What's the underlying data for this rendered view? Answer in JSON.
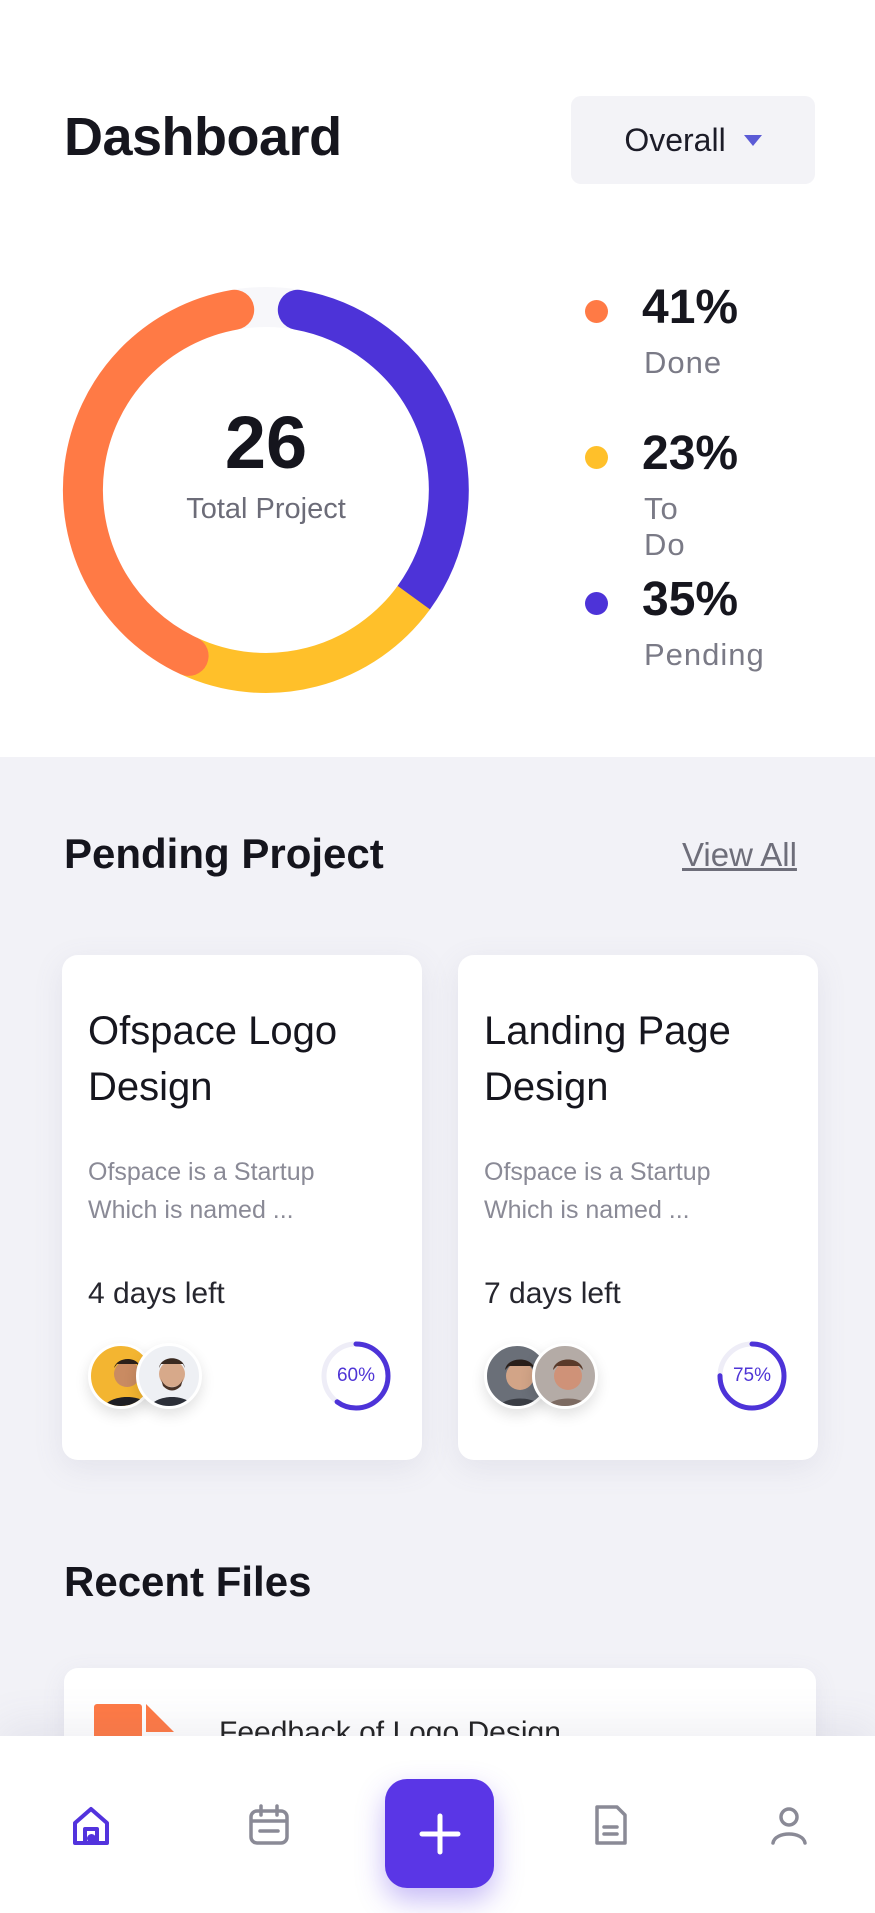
{
  "header": {
    "title": "Dashboard",
    "filter_label": "Overall"
  },
  "summary": {
    "total_value": "26",
    "total_label": "Total Project",
    "colors": {
      "done": "#ff7a45",
      "todo": "#ffc02a",
      "pending": "#4d33d8"
    },
    "legend": [
      {
        "pct": "41%",
        "label": "Done",
        "color": "#ff7a45"
      },
      {
        "pct": "23%",
        "label": "To Do",
        "color": "#ffc02a"
      },
      {
        "pct": "35%",
        "label": "Pending",
        "color": "#4d33d8"
      }
    ]
  },
  "pending": {
    "title": "Pending Project",
    "view_all": "View All",
    "cards": [
      {
        "title_line1": "Ofspace Logo",
        "title_line2": "Design",
        "desc_line1": "Ofspace is a Startup",
        "desc_line2": "Which is named ...",
        "days": "4 days left",
        "progress_label": "60%",
        "progress": 0.6
      },
      {
        "title_line1": "Landing Page",
        "title_line2": "Design",
        "desc_line1": "Ofspace is a Startup",
        "desc_line2": "Which is named ...",
        "days": "7 days left",
        "progress_label": "75%",
        "progress": 0.75
      }
    ]
  },
  "recent": {
    "title": "Recent Files",
    "files": [
      {
        "name": "Feedback of Logo Design",
        "icon": "file-icon"
      }
    ]
  },
  "tabbar": {
    "accent": "#5a36e6",
    "items": [
      "home-icon",
      "calendar-icon",
      "plus-icon",
      "document-icon",
      "profile-icon"
    ]
  }
}
